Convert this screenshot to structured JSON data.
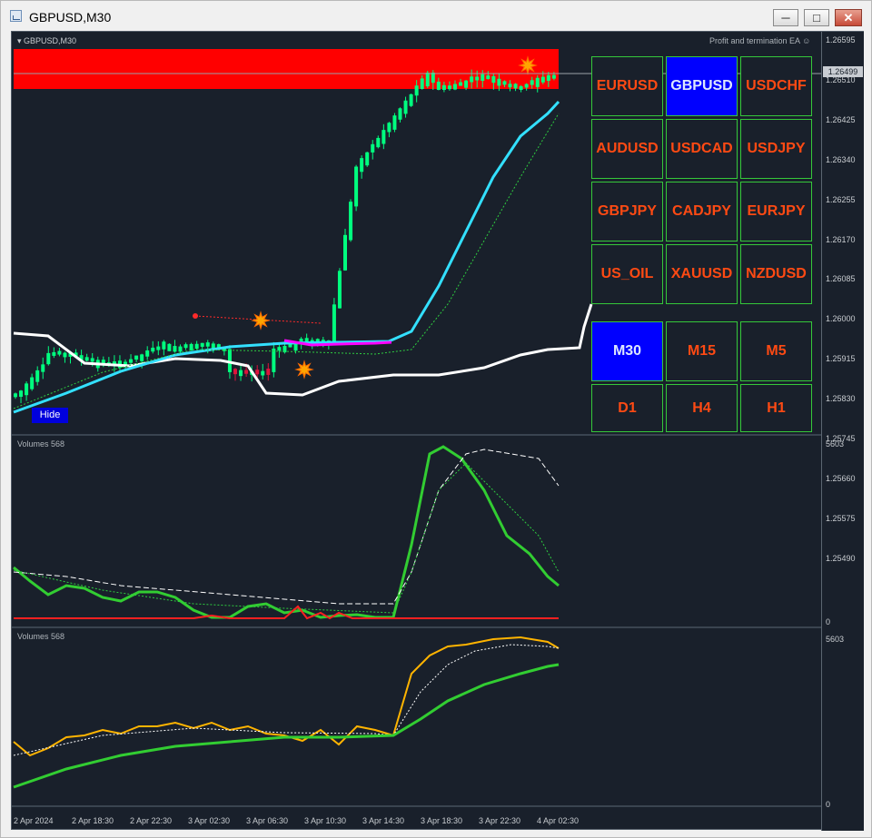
{
  "window": {
    "title": "GBPUSD,M30"
  },
  "chart": {
    "header": "GBPUSD,M30",
    "ea_label": "Profit and termination EA",
    "hide_label": "Hide",
    "price_axis": [
      "1.26595",
      "1.26510",
      "1.26425",
      "1.26340",
      "1.26255",
      "1.26170",
      "1.26085",
      "1.26000",
      "1.25915",
      "1.25830",
      "1.25745",
      "1.25660",
      "1.25575",
      "1.25490"
    ],
    "current_price": "1.26499"
  },
  "symbols": [
    {
      "label": "EURUSD",
      "active": false
    },
    {
      "label": "GBPUSD",
      "active": true
    },
    {
      "label": "USDCHF",
      "active": false
    },
    {
      "label": "AUDUSD",
      "active": false
    },
    {
      "label": "USDCAD",
      "active": false
    },
    {
      "label": "USDJPY",
      "active": false
    },
    {
      "label": "GBPJPY",
      "active": false
    },
    {
      "label": "CADJPY",
      "active": false
    },
    {
      "label": "EURJPY",
      "active": false
    },
    {
      "label": "US_OIL",
      "active": false
    },
    {
      "label": "XAUUSD",
      "active": false
    },
    {
      "label": "NZDUSD",
      "active": false
    }
  ],
  "timeframes": [
    {
      "label": "M30",
      "active": true
    },
    {
      "label": "M15",
      "active": false
    },
    {
      "label": "M5",
      "active": false
    },
    {
      "label": "D1",
      "active": false
    },
    {
      "label": "H4",
      "active": false
    },
    {
      "label": "H1",
      "active": false
    }
  ],
  "volumes1": {
    "label": "Volumes 568",
    "max": "5603",
    "min": "0"
  },
  "volumes2": {
    "label": "Volumes 568",
    "max": "5603",
    "min": "0"
  },
  "time_axis": [
    "2 Apr 2024",
    "2 Apr 18:30",
    "2 Apr 22:30",
    "3 Apr 02:30",
    "3 Apr 06:30",
    "3 Apr 10:30",
    "3 Apr 14:30",
    "3 Apr 18:30",
    "3 Apr 22:30",
    "4 Apr 02:30"
  ],
  "colors": {
    "background": "#19202b",
    "bull": "#00ff7f",
    "bear": "#dc143c",
    "band": "#ff0000",
    "ma_fast": "#33e0ff",
    "channel": "#ffffff",
    "volume_line": "#32cd32",
    "volume_alt": "#ffb400"
  }
}
